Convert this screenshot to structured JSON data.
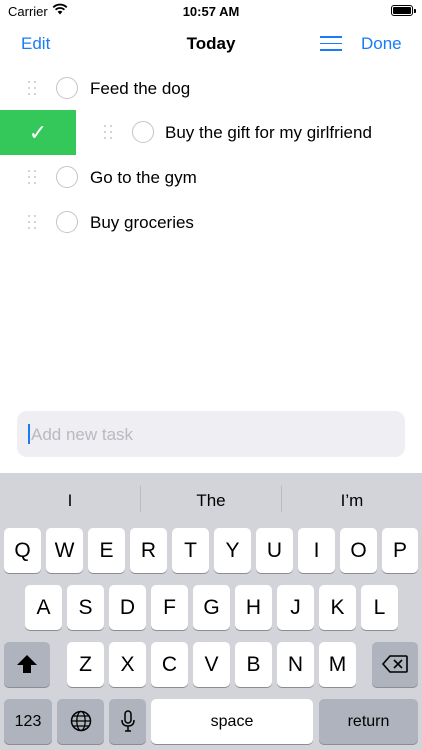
{
  "status_bar": {
    "carrier": "Carrier",
    "time": "10:57 AM"
  },
  "nav": {
    "edit": "Edit",
    "title": "Today",
    "done": "Done"
  },
  "tasks": [
    {
      "title": "Feed the dog"
    },
    {
      "title": "Buy the gift for my girlfriend"
    },
    {
      "title": "Go to the gym"
    },
    {
      "title": "Buy groceries"
    }
  ],
  "swipe_action": {
    "glyph": "✓",
    "color": "#34c759"
  },
  "add_task": {
    "placeholder": "Add new task",
    "value": ""
  },
  "keyboard": {
    "suggestions": [
      "I",
      "The",
      "I’m"
    ],
    "row1": [
      "Q",
      "W",
      "E",
      "R",
      "T",
      "Y",
      "U",
      "I",
      "O",
      "P"
    ],
    "row2": [
      "A",
      "S",
      "D",
      "F",
      "G",
      "H",
      "J",
      "K",
      "L"
    ],
    "row3": [
      "Z",
      "X",
      "C",
      "V",
      "B",
      "N",
      "M"
    ],
    "numbers_label": "123",
    "space_label": "space",
    "return_label": "return"
  },
  "accent_color": "#1a7cf5"
}
